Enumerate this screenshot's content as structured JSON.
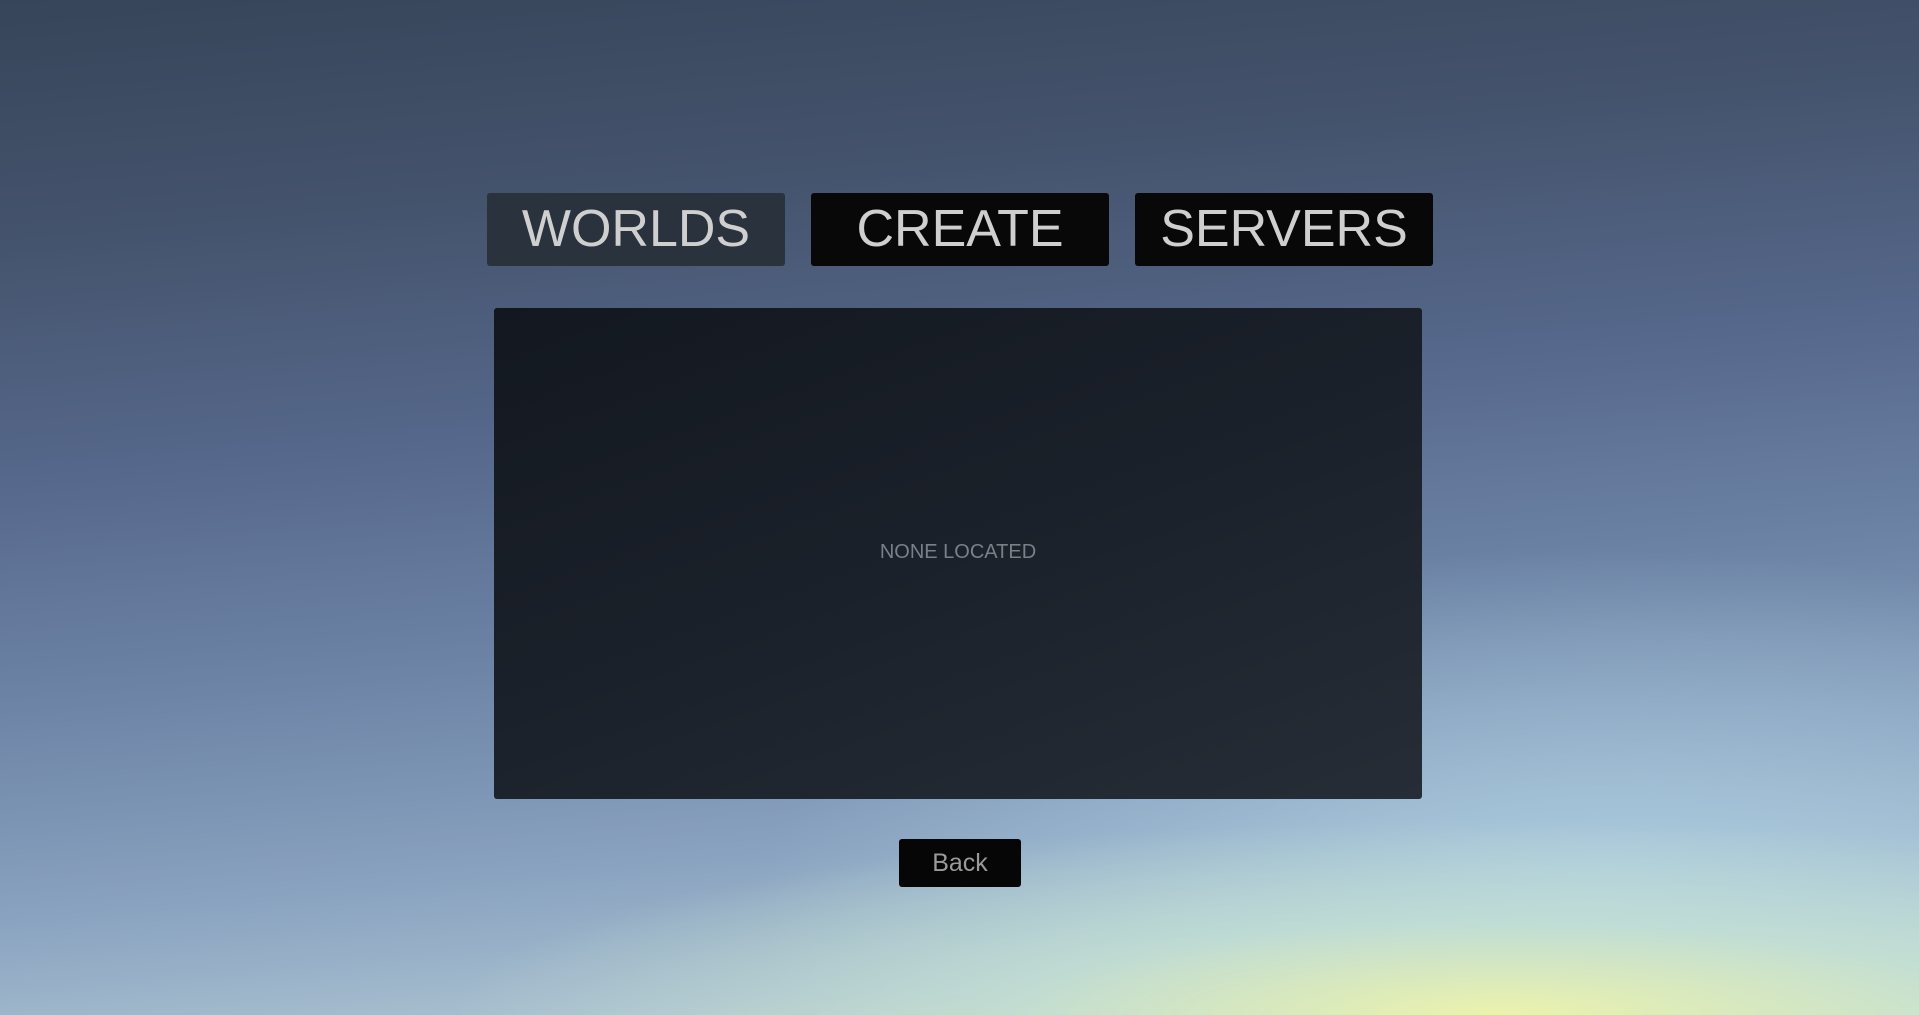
{
  "tabs": [
    {
      "label": "WORLDS",
      "selected": true
    },
    {
      "label": "CREATE",
      "selected": false
    },
    {
      "label": "SERVERS",
      "selected": false
    }
  ],
  "list": {
    "empty_message": "NONE LOCATED"
  },
  "footer": {
    "back_label": "Back"
  },
  "colors": {
    "tab_selected_bg": "#2a323e",
    "tab_bg": "#080808",
    "tab_text": "#cfcfcf",
    "panel_bg": "#1b212a",
    "empty_text": "#7b7f86"
  }
}
